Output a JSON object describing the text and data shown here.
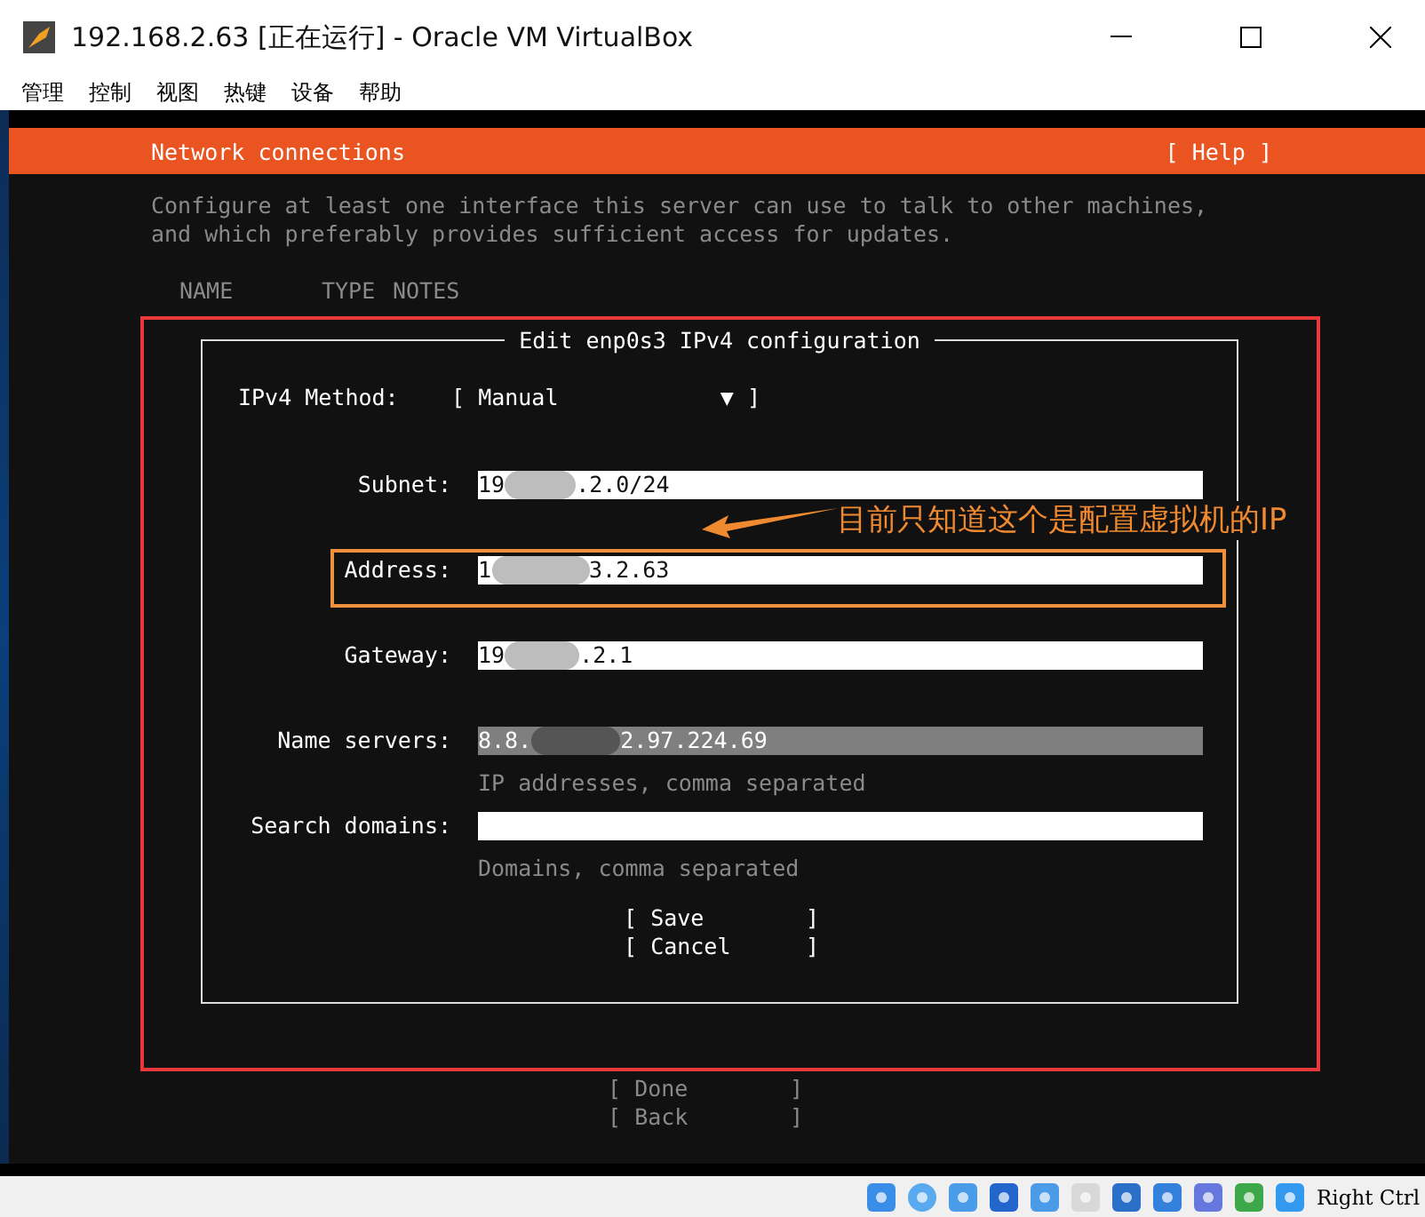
{
  "window": {
    "title": "192.168.2.63 [正在运行] - Oracle VM VirtualBox",
    "menu": [
      "管理",
      "控制",
      "视图",
      "热键",
      "设备",
      "帮助"
    ]
  },
  "installer": {
    "title": "Network connections",
    "help": "[ Help ]",
    "description": [
      "Configure at least one interface this server can use to talk to other machines,",
      "and which preferably provides sufficient access for updates."
    ],
    "columns": [
      "NAME",
      "TYPE",
      "NOTES"
    ],
    "dialog": {
      "title": "Edit enp0s3 IPv4 configuration",
      "method_label": "IPv4 Method:",
      "method_open": "[",
      "method_value": "Manual",
      "method_arrow": "▼",
      "method_close": "]",
      "fields": [
        {
          "label": "Subnet:",
          "value_start": "19",
          "value_end": ".2.0/24",
          "selected": false
        },
        {
          "label": "Address:",
          "value_start": "1",
          "value_end": "3.2.63",
          "selected": false
        },
        {
          "label": "Gateway:",
          "value_start": "19",
          "value_end": ".2.1",
          "selected": false
        },
        {
          "label": "Name servers:",
          "value_start": "8.8.",
          "value_end": "2.97.224.69",
          "hint": "IP addresses, comma separated",
          "selected": true
        },
        {
          "label": "Search domains:",
          "hint": "Domains, comma separated",
          "selected": false
        }
      ],
      "buttons": [
        {
          "open": "[",
          "label": "Save",
          "close": "]"
        },
        {
          "open": "[",
          "label": "Cancel",
          "close": "]"
        }
      ]
    },
    "footer_buttons": [
      {
        "open": "[",
        "label": "Done",
        "close": "]",
        "disabled": true
      },
      {
        "open": "[",
        "label": "Back",
        "close": "]",
        "disabled": true
      }
    ]
  },
  "annotation": {
    "text": "目前只知道这个是配置虚拟机的IP"
  },
  "status_bar": {
    "host_key": "Right Ctrl"
  }
}
